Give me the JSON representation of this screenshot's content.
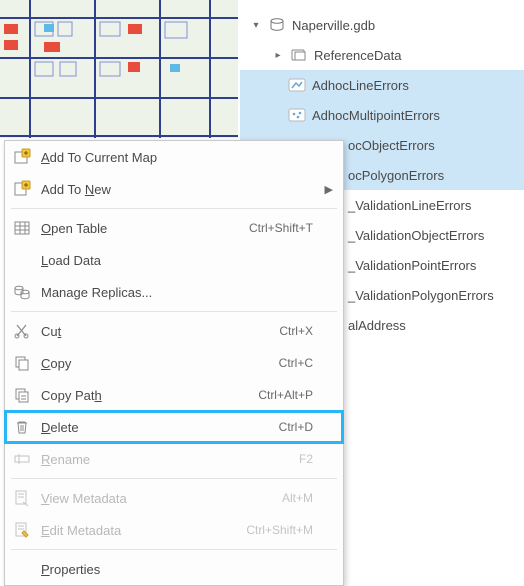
{
  "tree": {
    "root": {
      "label": "Naperville.gdb",
      "expanded": true
    },
    "group": {
      "label": "ReferenceData",
      "expanded": false
    },
    "items": [
      {
        "label": "AdhocLineErrors",
        "selected": true,
        "icon": "line"
      },
      {
        "label": "AdhocMultipointErrors",
        "selected": true,
        "icon": "multipoint"
      },
      {
        "label": "AdhocObjectErrors",
        "selected": true,
        "icon": "table",
        "clip": "ocObjectErrors"
      },
      {
        "label": "AdhocPolygonErrors",
        "selected": true,
        "icon": "polygon",
        "clip": "ocPolygonErrors"
      },
      {
        "label": "Adhoc_ValidationLineErrors",
        "selected": false,
        "icon": "line",
        "clip": "_ValidationLineErrors"
      },
      {
        "label": "Adhoc_ValidationObjectErrors",
        "selected": false,
        "icon": "table",
        "clip": "_ValidationObjectErrors"
      },
      {
        "label": "Adhoc_ValidationPointErrors",
        "selected": false,
        "icon": "point",
        "clip": "_ValidationPointErrors"
      },
      {
        "label": "Adhoc_ValidationPolygonErrors",
        "selected": false,
        "icon": "polygon",
        "clip": "_ValidationPolygonErrors"
      },
      {
        "label": "PostalAddress",
        "selected": false,
        "icon": "table",
        "clip": "alAddress"
      }
    ]
  },
  "context_menu": {
    "items": [
      {
        "label": "Add To Current Map",
        "html": "<u>A</u>dd To Current Map",
        "icon": "add-map",
        "shortcut": "",
        "submenu": false,
        "disabled": false
      },
      {
        "label": "Add To New",
        "html": "Add To <u>N</u>ew",
        "icon": "add-new",
        "shortcut": "",
        "submenu": true,
        "disabled": false
      },
      {
        "sep": true
      },
      {
        "label": "Open Table",
        "html": "<u>O</u>pen Table",
        "icon": "table",
        "shortcut": "Ctrl+Shift+T",
        "submenu": false,
        "disabled": false
      },
      {
        "label": "Load Data",
        "html": "<u>L</u>oad Data",
        "icon": "",
        "shortcut": "",
        "submenu": false,
        "disabled": false
      },
      {
        "label": "Manage Replicas...",
        "html": "Manage Replicas...",
        "icon": "replicas",
        "shortcut": "",
        "submenu": false,
        "disabled": false
      },
      {
        "sep": true
      },
      {
        "label": "Cut",
        "html": "Cu<u>t</u>",
        "icon": "cut",
        "shortcut": "Ctrl+X",
        "submenu": false,
        "disabled": false
      },
      {
        "label": "Copy",
        "html": "<u>C</u>opy",
        "icon": "copy",
        "shortcut": "Ctrl+C",
        "submenu": false,
        "disabled": false
      },
      {
        "label": "Copy Path",
        "html": "Copy Pat<u>h</u>",
        "icon": "copypath",
        "shortcut": "Ctrl+Alt+P",
        "submenu": false,
        "disabled": false
      },
      {
        "label": "Delete",
        "html": "<u>D</u>elete",
        "icon": "delete",
        "shortcut": "Ctrl+D",
        "submenu": false,
        "disabled": false,
        "highlight": true
      },
      {
        "label": "Rename",
        "html": "<u>R</u>ename",
        "icon": "rename",
        "shortcut": "F2",
        "submenu": false,
        "disabled": true
      },
      {
        "sep": true
      },
      {
        "label": "View Metadata",
        "html": "<u>V</u>iew Metadata",
        "icon": "viewmeta",
        "shortcut": "Alt+M",
        "submenu": false,
        "disabled": true
      },
      {
        "label": "Edit Metadata",
        "html": "<u>E</u>dit Metadata",
        "icon": "editmeta",
        "shortcut": "Ctrl+Shift+M",
        "submenu": false,
        "disabled": true
      },
      {
        "sep": true
      },
      {
        "label": "Properties",
        "html": "<u>P</u>roperties",
        "icon": "",
        "shortcut": "",
        "submenu": false,
        "disabled": false
      }
    ]
  }
}
